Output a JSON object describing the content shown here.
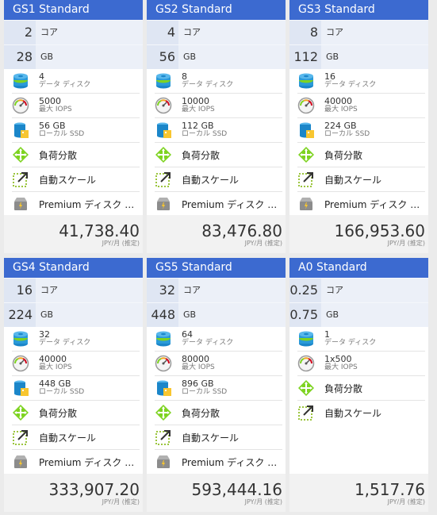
{
  "price_unit": "JPY/月 (推定)",
  "colors": {
    "header": "#3c6ad0",
    "spec_bg": "#ecf0f8",
    "num_bg": "#dfe6f3"
  },
  "cards": [
    {
      "name": "GS1",
      "tier": "Standard",
      "cores": "2",
      "core_unit": "コア",
      "ram": "28",
      "ram_unit": "GB",
      "disks": "4",
      "disks_label": "データ ディスク",
      "iops": "5000",
      "iops_label": "最大 IOPS",
      "ssd": "56 GB",
      "ssd_label": "ローカル SSD",
      "lb": "負荷分散",
      "autoscale": "自動スケール",
      "premium": "Premium ディスク サ…",
      "price": "41,738.40"
    },
    {
      "name": "GS2",
      "tier": "Standard",
      "cores": "4",
      "core_unit": "コア",
      "ram": "56",
      "ram_unit": "GB",
      "disks": "8",
      "disks_label": "データ ディスク",
      "iops": "10000",
      "iops_label": "最大 IOPS",
      "ssd": "112 GB",
      "ssd_label": "ローカル SSD",
      "lb": "負荷分散",
      "autoscale": "自動スケール",
      "premium": "Premium ディスク サ…",
      "price": "83,476.80"
    },
    {
      "name": "GS3",
      "tier": "Standard",
      "cores": "8",
      "core_unit": "コア",
      "ram": "112",
      "ram_unit": "GB",
      "disks": "16",
      "disks_label": "データ ディスク",
      "iops": "40000",
      "iops_label": "最大 IOPS",
      "ssd": "224 GB",
      "ssd_label": "ローカル SSD",
      "lb": "負荷分散",
      "autoscale": "自動スケール",
      "premium": "Premium ディスク サ…",
      "price": "166,953.60"
    },
    {
      "name": "GS4",
      "tier": "Standard",
      "cores": "16",
      "core_unit": "コア",
      "ram": "224",
      "ram_unit": "GB",
      "disks": "32",
      "disks_label": "データ ディスク",
      "iops": "40000",
      "iops_label": "最大 IOPS",
      "ssd": "448 GB",
      "ssd_label": "ローカル SSD",
      "lb": "負荷分散",
      "autoscale": "自動スケール",
      "premium": "Premium ディスク サ…",
      "price": "333,907.20"
    },
    {
      "name": "GS5",
      "tier": "Standard",
      "cores": "32",
      "core_unit": "コア",
      "ram": "448",
      "ram_unit": "GB",
      "disks": "64",
      "disks_label": "データ ディスク",
      "iops": "80000",
      "iops_label": "最大 IOPS",
      "ssd": "896 GB",
      "ssd_label": "ローカル SSD",
      "lb": "負荷分散",
      "autoscale": "自動スケール",
      "premium": "Premium ディスク サ…",
      "price": "593,444.16"
    },
    {
      "name": "A0",
      "tier": "Standard",
      "cores": "0.25",
      "core_unit": "コア",
      "ram": "0.75",
      "ram_unit": "GB",
      "disks": "1",
      "disks_label": "データ ディスク",
      "iops": "1x500",
      "iops_label": "最大 IOPS",
      "lb": "負荷分散",
      "autoscale": "自動スケール",
      "price": "1,517.76"
    }
  ]
}
